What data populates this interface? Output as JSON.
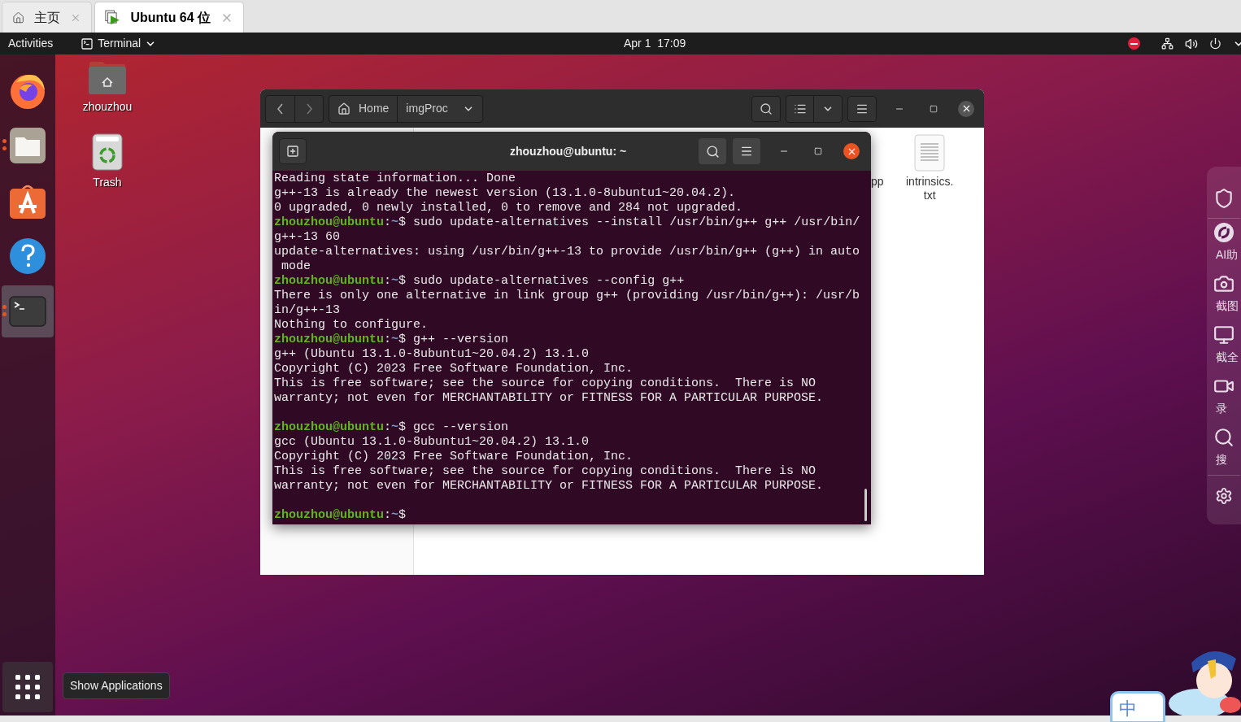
{
  "browser_tabs": [
    {
      "kind": "home",
      "label": "主页",
      "selected": false
    },
    {
      "kind": "vm",
      "label": "Ubuntu 64 位",
      "selected": true
    }
  ],
  "top_bar": {
    "activities": "Activities",
    "app_menu": "Terminal",
    "clock": "Apr 1  17:09"
  },
  "dock": {
    "items": [
      {
        "kind": "firefox",
        "running": false,
        "selected": false
      },
      {
        "kind": "files",
        "running": true,
        "selected": false
      },
      {
        "kind": "software",
        "running": false,
        "selected": false
      },
      {
        "kind": "help",
        "running": false,
        "selected": false
      },
      {
        "kind": "terminal",
        "running": true,
        "selected": true
      }
    ],
    "tooltip": "Show Applications"
  },
  "desktop_icons": [
    {
      "kind": "home",
      "label": "zhouzhou"
    },
    {
      "kind": "trash",
      "label": "Trash"
    }
  ],
  "file_manager": {
    "path": [
      "Home",
      "imgProc"
    ],
    "files": [
      {
        "kind": "hidden",
        "label": "pp"
      },
      {
        "kind": "text",
        "label": "intrinsics.\ntxt"
      }
    ]
  },
  "terminal": {
    "title": "zhouzhou@ubuntu: ~",
    "lines": [
      {
        "kind": "output",
        "text": "Reading state information... Done"
      },
      {
        "kind": "output",
        "text": "g++-13 is already the newest version (13.1.0-8ubuntu1~20.04.2)."
      },
      {
        "kind": "output",
        "text": "0 upgraded, 0 newly installed, 0 to remove and 284 not upgraded."
      },
      {
        "kind": "prompt",
        "user": "zhouzhou@ubuntu",
        "separator": ":",
        "path": "~",
        "symbol": "$",
        "command": "sudo update-alternatives --install /usr/bin/g++ g++ /usr/bin/"
      },
      {
        "kind": "output",
        "text": "g++-13 60"
      },
      {
        "kind": "output",
        "text": "update-alternatives: using /usr/bin/g++-13 to provide /usr/bin/g++ (g++) in auto"
      },
      {
        "kind": "output",
        "text": " mode"
      },
      {
        "kind": "prompt",
        "user": "zhouzhou@ubuntu",
        "separator": ":",
        "path": "~",
        "symbol": "$",
        "command": "sudo update-alternatives --config g++"
      },
      {
        "kind": "output",
        "text": "There is only one alternative in link group g++ (providing /usr/bin/g++): /usr/b"
      },
      {
        "kind": "output",
        "text": "in/g++-13"
      },
      {
        "kind": "output",
        "text": "Nothing to configure."
      },
      {
        "kind": "prompt",
        "user": "zhouzhou@ubuntu",
        "separator": ":",
        "path": "~",
        "symbol": "$",
        "command": "g++ --version"
      },
      {
        "kind": "output",
        "text": "g++ (Ubuntu 13.1.0-8ubuntu1~20.04.2) 13.1.0"
      },
      {
        "kind": "output",
        "text": "Copyright (C) 2023 Free Software Foundation, Inc."
      },
      {
        "kind": "output",
        "text": "This is free software; see the source for copying conditions.  There is NO"
      },
      {
        "kind": "output",
        "text": "warranty; not even for MERCHANTABILITY or FITNESS FOR A PARTICULAR PURPOSE."
      },
      {
        "kind": "blank"
      },
      {
        "kind": "prompt",
        "user": "zhouzhou@ubuntu",
        "separator": ":",
        "path": "~",
        "symbol": "$",
        "command": "gcc --version"
      },
      {
        "kind": "output",
        "text": "gcc (Ubuntu 13.1.0-8ubuntu1~20.04.2) 13.1.0"
      },
      {
        "kind": "output",
        "text": "Copyright (C) 2023 Free Software Foundation, Inc."
      },
      {
        "kind": "output",
        "text": "This is free software; see the source for copying conditions.  There is NO"
      },
      {
        "kind": "output",
        "text": "warranty; not even for MERCHANTABILITY or FITNESS FOR A PARTICULAR PURPOSE."
      },
      {
        "kind": "blank"
      },
      {
        "kind": "prompt",
        "user": "zhouzhou@ubuntu",
        "separator": ":",
        "path": "~",
        "symbol": "$"
      }
    ]
  },
  "side_panel": {
    "items": [
      {
        "kind": "shield"
      },
      {
        "kind": "ai",
        "label": "AI助"
      },
      {
        "kind": "camera",
        "label": "截图"
      },
      {
        "kind": "monitor",
        "label": "截全"
      },
      {
        "kind": "video",
        "label": "录"
      },
      {
        "kind": "search",
        "label": "搜"
      },
      {
        "kind": "settings"
      }
    ]
  },
  "ime": {
    "label": "中"
  }
}
